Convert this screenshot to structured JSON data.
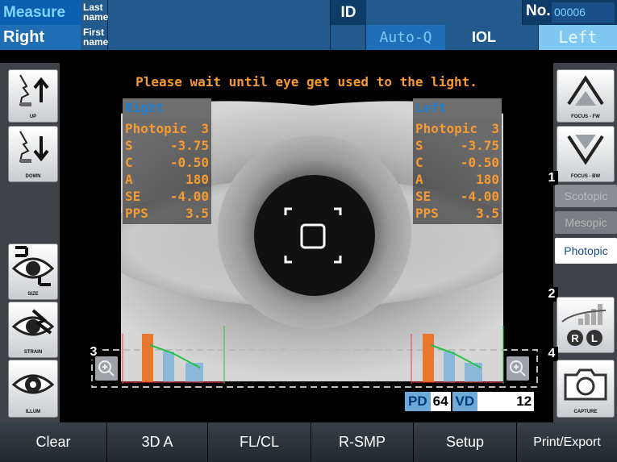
{
  "header": {
    "mode": "Measure",
    "eye_side": "Right",
    "last_name_label": "Last\nname",
    "first_name_label": "First\nname",
    "id_label": "ID",
    "no_label": "No.",
    "no_value": "00006",
    "auto_q": "Auto-Q",
    "iol": "IOL",
    "left": "Left"
  },
  "message": "Please wait until eye get used to the light.",
  "right_panel": {
    "title": "Right",
    "rows": [
      {
        "k": "Photopic",
        "v": "3"
      },
      {
        "k": "S",
        "v": "-3.75"
      },
      {
        "k": "C",
        "v": "-0.50"
      },
      {
        "k": "A",
        "v": "180"
      },
      {
        "k": "SE",
        "v": "-4.00"
      },
      {
        "k": "PPS",
        "v": "3.5"
      }
    ]
  },
  "left_panel": {
    "title": "Left",
    "rows": [
      {
        "k": "Photopic",
        "v": "3"
      },
      {
        "k": "S",
        "v": "-3.75"
      },
      {
        "k": "C",
        "v": "-0.50"
      },
      {
        "k": "A",
        "v": "180"
      },
      {
        "k": "SE",
        "v": "-4.00"
      },
      {
        "k": "PPS",
        "v": "3.5"
      }
    ]
  },
  "left_controls": {
    "up": "UP",
    "down": "DOWN",
    "size": "SIZE",
    "strain": "STRAIN",
    "illum": "ILLUM"
  },
  "right_controls": {
    "focus_fw": "FOCUS - FW",
    "focus_bw": "FOCUS - BW",
    "scotopic": "Scotopic",
    "mesopic": "Mesopic",
    "photopic": "Photopic",
    "r": "R",
    "l": "L",
    "capture": "CAPTURE"
  },
  "badges": {
    "b1": "1",
    "b2": "2",
    "b3": "3",
    "b4": "4"
  },
  "pd": {
    "label": "PD",
    "value": "64"
  },
  "vd": {
    "label": "VD",
    "value": "12"
  },
  "bottom": {
    "clear": "Clear",
    "a3d": "3D A",
    "flcl": "FL/CL",
    "rsmp": "R-SMP",
    "setup": "Setup",
    "print": "Print/Export"
  },
  "colors": {
    "accent_orange": "#f79a32",
    "title_blue": "#1e7fcf",
    "header_blue": "#1a4470"
  }
}
